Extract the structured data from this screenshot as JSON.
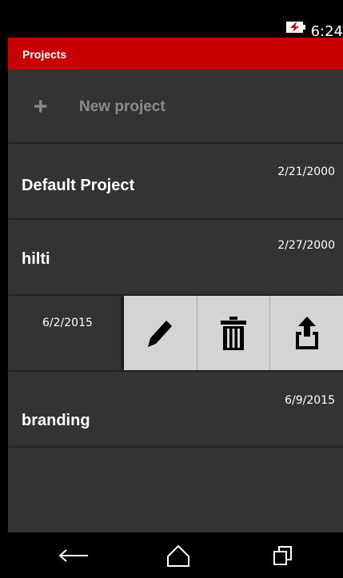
{
  "status_bar": {
    "time": "6:24",
    "battery_icon": "battery-charging-icon"
  },
  "app_bar": {
    "title": "Projects"
  },
  "new_project": {
    "plus_symbol": "+",
    "label": "New project"
  },
  "projects": [
    {
      "name": "Default Project",
      "date": "2/21/2000"
    },
    {
      "name": "hilti",
      "date": "2/27/2000"
    },
    {
      "name": "",
      "date": "6/2/2015"
    },
    {
      "name": "branding",
      "date": "6/9/2015"
    }
  ],
  "row_actions": {
    "icons": [
      "pencil-icon",
      "trash-icon",
      "share-icon"
    ]
  },
  "nav_bar": {
    "icons": [
      "back-arrow-icon",
      "home-icon",
      "recent-apps-icon"
    ]
  },
  "colors": {
    "accent": "#c90000",
    "list_background": "#333333",
    "action_background": "#d4d4d4",
    "muted_text": "#8a8a8a"
  }
}
